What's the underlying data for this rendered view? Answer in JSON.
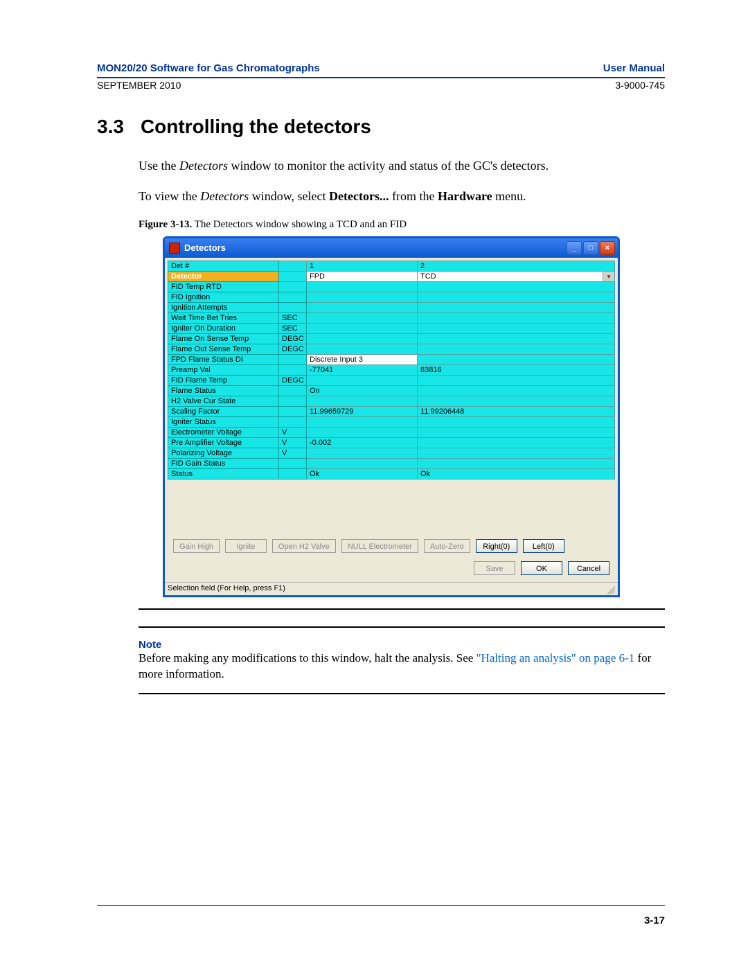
{
  "header": {
    "title_left": "MON20/20 Software for Gas Chromatographs",
    "title_right": "User Manual",
    "sub_left": "SEPTEMBER 2010",
    "sub_right": "3-9000-745"
  },
  "section": {
    "number": "3.3",
    "title": "Controlling the detectors"
  },
  "para1_a": "Use the ",
  "para1_b": "Detectors",
  "para1_c": " window to monitor the activity and status of the GC's detectors.",
  "para2_a": "To view the ",
  "para2_b": "Detectors",
  "para2_c": " window, select ",
  "para2_d": "Detectors...",
  "para2_e": " from the ",
  "para2_f": "Hardware",
  "para2_g": " menu.",
  "figure": {
    "label": "Figure 3-13.",
    "caption": "The Detectors window showing a TCD and an FID"
  },
  "window": {
    "title": "Detectors",
    "status": "Selection field (For Help, press F1)",
    "columns": {
      "det": "Det #",
      "c1": "1",
      "c2": "2"
    },
    "detector_row_label": "Detector",
    "col1_type": "FPD",
    "col2_type": "TCD",
    "rows": [
      {
        "label": "FID Temp RTD",
        "unit": "",
        "v1": "",
        "v2": ""
      },
      {
        "label": "FID Ignition",
        "unit": "",
        "v1": "",
        "v2": ""
      },
      {
        "label": "Ignition Attempts",
        "unit": "",
        "v1": "",
        "v2": ""
      },
      {
        "label": "Wait Time Bet Tries",
        "unit": "SEC",
        "v1": "",
        "v2": ""
      },
      {
        "label": "Igniter On Duration",
        "unit": "SEC",
        "v1": "",
        "v2": ""
      },
      {
        "label": "Flame On Sense Temp",
        "unit": "DEGC",
        "v1": "",
        "v2": ""
      },
      {
        "label": "Flame Out Sense Temp",
        "unit": "DEGC",
        "v1": "",
        "v2": ""
      },
      {
        "label": "FPD Flame Status DI",
        "unit": "",
        "v1": "Discrete Input 3",
        "v2": "",
        "white1": true
      },
      {
        "label": "Preamp Val",
        "unit": "",
        "v1": "-77041",
        "v2": "83816"
      },
      {
        "label": "FID Flame Temp",
        "unit": "DEGC",
        "v1": "",
        "v2": ""
      },
      {
        "label": "Flame Status",
        "unit": "",
        "v1": "On",
        "v2": ""
      },
      {
        "label": "H2 Valve Cur State",
        "unit": "",
        "v1": "",
        "v2": ""
      },
      {
        "label": "Scaling Factor",
        "unit": "",
        "v1": "11.99659729",
        "v2": "11.99206448"
      },
      {
        "label": "Igniter Status",
        "unit": "",
        "v1": "",
        "v2": ""
      },
      {
        "label": "Electrometer Voltage",
        "unit": "V",
        "v1": "",
        "v2": ""
      },
      {
        "label": "Pre Amplifier Voltage",
        "unit": "V",
        "v1": "-0.002",
        "v2": ""
      },
      {
        "label": "Polarizing Voltage",
        "unit": "V",
        "v1": "",
        "v2": ""
      },
      {
        "label": "FID Gain Status",
        "unit": "",
        "v1": "",
        "v2": ""
      },
      {
        "label": "Status",
        "unit": "",
        "v1": "Ok",
        "v2": "Ok"
      }
    ],
    "buttons_top": [
      {
        "label": "Gain High",
        "enabled": false
      },
      {
        "label": "Ignite",
        "enabled": false
      },
      {
        "label": "Open H2 Valve",
        "enabled": false
      },
      {
        "label": "NULL Electrometer",
        "enabled": false
      },
      {
        "label": "Auto-Zero",
        "enabled": false
      },
      {
        "label": "Right(0)",
        "enabled": true
      },
      {
        "label": "Left(0)",
        "enabled": true
      }
    ],
    "buttons_bottom": [
      {
        "label": "Save",
        "enabled": false
      },
      {
        "label": "OK",
        "enabled": true
      },
      {
        "label": "Cancel",
        "enabled": true
      }
    ]
  },
  "note": {
    "heading": "Note",
    "body_a": "Before making any modifications to this window, halt the analysis. See ",
    "link": "\"Halting an analysis\" on page 6-1",
    "body_b": " for more information."
  },
  "page_number": "3-17"
}
